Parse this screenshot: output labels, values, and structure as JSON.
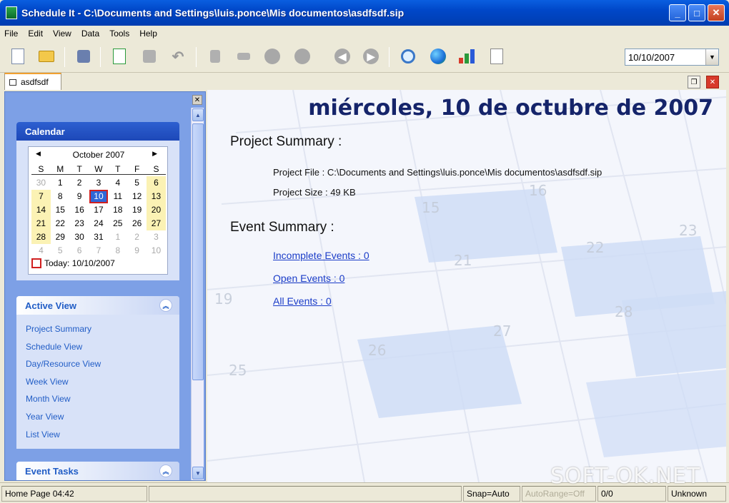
{
  "window": {
    "title": "Schedule It - C:\\Documents and Settings\\luis.ponce\\Mis documentos\\asdfsdf.sip"
  },
  "menu": [
    "File",
    "Edit",
    "View",
    "Data",
    "Tools",
    "Help"
  ],
  "toolbar": {
    "icons": [
      "new-document-icon",
      "open-folder-icon",
      "schedule-view-icon",
      "add-event-icon",
      "add-resource-icon",
      "undo-icon",
      "filter-icon",
      "split-icon",
      "award-icon",
      "recurrence-icon",
      "back-arrow-icon",
      "forward-arrow-icon",
      "search-icon",
      "globe-icon",
      "chart-icon",
      "report-icon"
    ],
    "date_value": "10/10/2007"
  },
  "tabs": [
    {
      "label": "asdfsdf"
    }
  ],
  "calendar_panel": {
    "title": "Calendar",
    "month_label": "October 2007",
    "weekdays": [
      "S",
      "M",
      "T",
      "W",
      "T",
      "F",
      "S"
    ],
    "weeks": [
      [
        "30",
        "1",
        "2",
        "3",
        "4",
        "5",
        "6"
      ],
      [
        "7",
        "8",
        "9",
        "10",
        "11",
        "12",
        "13"
      ],
      [
        "14",
        "15",
        "16",
        "17",
        "18",
        "19",
        "20"
      ],
      [
        "21",
        "22",
        "23",
        "24",
        "25",
        "26",
        "27"
      ],
      [
        "28",
        "29",
        "30",
        "31",
        "1",
        "2",
        "3"
      ],
      [
        "4",
        "5",
        "6",
        "7",
        "8",
        "9",
        "10"
      ]
    ],
    "today_label": "Today: 10/10/2007"
  },
  "active_view": {
    "title": "Active View",
    "items": [
      "Project Summary",
      "Schedule View",
      "Day/Resource View",
      "Week View",
      "Month View",
      "Year View",
      "List View"
    ]
  },
  "event_tasks": {
    "title": "Event Tasks"
  },
  "main": {
    "date_heading": "miércoles, 10 de octubre de 2007",
    "project_summary_title": "Project Summary :",
    "project_file": "Project File : C:\\Documents and Settings\\luis.ponce\\Mis documentos\\asdfsdf.sip",
    "project_size": "Project Size : 49 KB",
    "event_summary_title": "Event Summary :",
    "links": [
      "Incomplete Events : 0",
      "Open Events : 0",
      "All Events : 0"
    ],
    "bg_numbers": [
      "15",
      "16",
      "21",
      "22",
      "23",
      "26",
      "27",
      "28",
      "25",
      "19"
    ]
  },
  "status": {
    "home": "Home Page 04:42",
    "snap": "Snap=Auto",
    "autorange": "AutoRange=Off",
    "count": "0/0",
    "unknown": "Unknown"
  },
  "watermark": "SOFT-OK.NET"
}
